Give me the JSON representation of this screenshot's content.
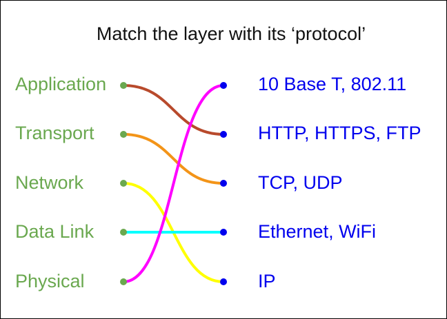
{
  "title": "Match the layer with its ‘protocol’",
  "layers": [
    "Application",
    "Transport",
    "Network",
    "Data Link",
    "Physical"
  ],
  "protocols": [
    "10 Base T, 802.11",
    "HTTP, HTTPS, FTP",
    "TCP, UDP",
    "Ethernet, WiFi",
    "IP"
  ],
  "matches": [
    {
      "layer": "Application",
      "protocol": "HTTP, HTTPS, FTP",
      "color": "#b84a2c"
    },
    {
      "layer": "Transport",
      "protocol": "TCP, UDP",
      "color": "#f39418"
    },
    {
      "layer": "Network",
      "protocol": "IP",
      "color": "#ffff00"
    },
    {
      "layer": "Data Link",
      "protocol": "Ethernet, WiFi",
      "color": "#00ffff"
    },
    {
      "layer": "Physical",
      "protocol": "10 Base T, 802.11",
      "color": "#ff00ff"
    }
  ],
  "colors": {
    "layer_text": "#6aa84f",
    "protocol_text": "#0000ee",
    "left_dot": "#6aa84f",
    "right_dot": "#0000ee"
  }
}
